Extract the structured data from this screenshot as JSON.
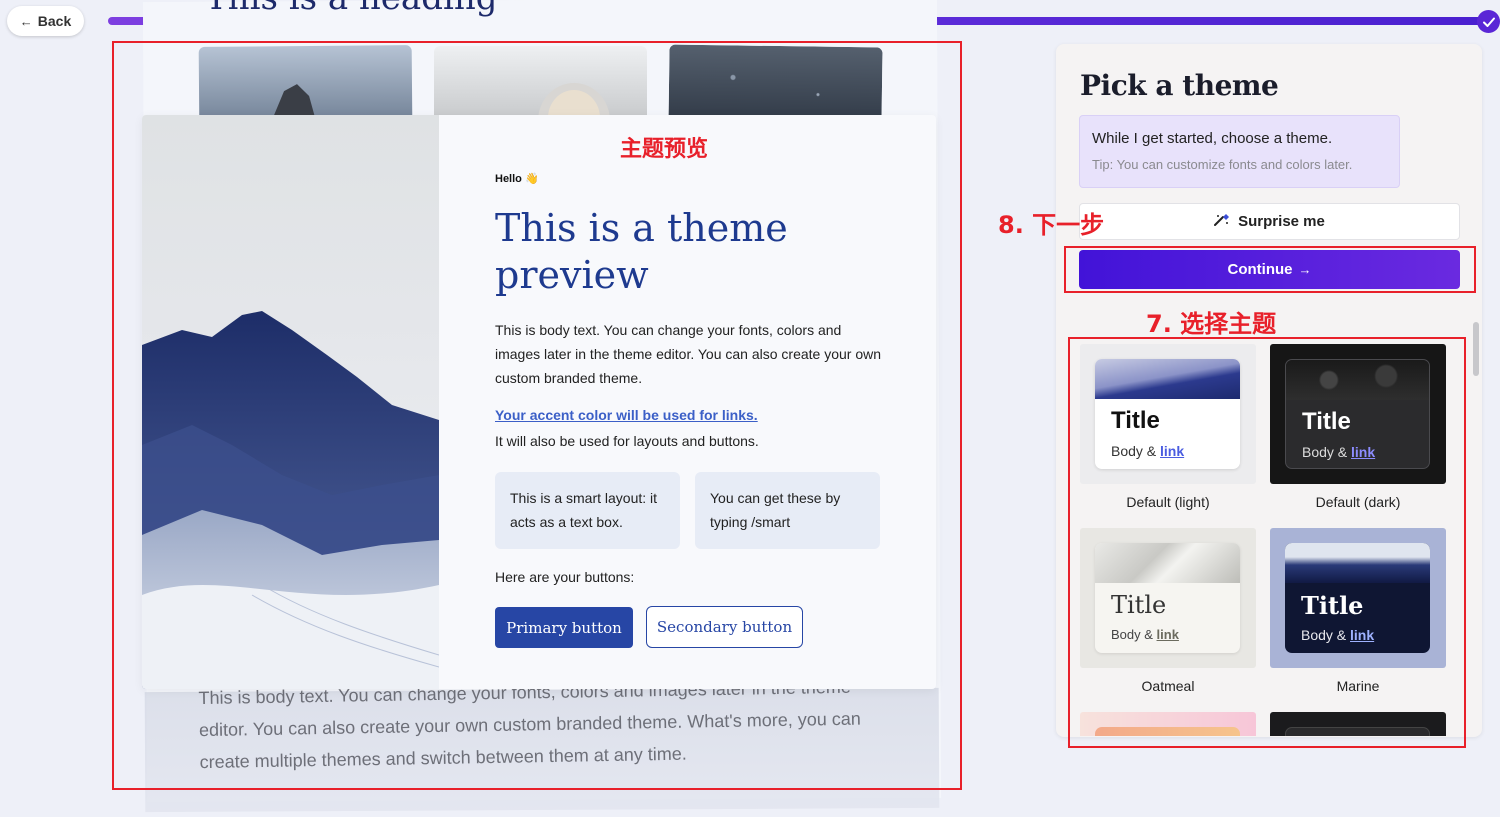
{
  "nav": {
    "back_label": "Back"
  },
  "background_doc": {
    "heading": "This is a heading",
    "body_text": "This is body text. You can change your fonts, colors and images later in the theme editor. You can also create your own custom branded theme. What's more, you can create multiple themes and switch between them at any time."
  },
  "preview": {
    "hello": "Hello 👋",
    "title": "This is a theme preview",
    "body": "This is body text. You can change your fonts, colors and images later in the theme editor. You can also create your own custom branded theme.",
    "accent_link": "Your accent color will be used for links.",
    "accent_note": "It will also be used for layouts and buttons.",
    "smart_box_1": "This is a smart layout: it acts as a  text box.",
    "smart_box_2": "You can get these by typing /smart",
    "buttons_label": "Here are your buttons:",
    "primary_button": "Primary button",
    "secondary_button": "Secondary button"
  },
  "annotations": {
    "preview_label": "主题预览",
    "next_label": "8. 下一步",
    "choose_label": "7. 选择主题",
    "color": "#e8202a"
  },
  "panel": {
    "title": "Pick a theme",
    "tip_main": "While I get started, choose a theme.",
    "tip_sub": "Tip: You can customize fonts and colors later.",
    "surprise_label": "Surprise me",
    "continue_label": "Continue",
    "themes": [
      {
        "name": "Default (light)",
        "card_title": "Title",
        "card_body": "Body & ",
        "card_link": "link"
      },
      {
        "name": "Default (dark)",
        "card_title": "Title",
        "card_body": "Body & ",
        "card_link": "link"
      },
      {
        "name": "Oatmeal",
        "card_title": "Title",
        "card_body": "Body & ",
        "card_link": "link"
      },
      {
        "name": "Marine",
        "card_title": "Title",
        "card_body": "Body & ",
        "card_link": "link"
      }
    ]
  },
  "colors": {
    "accent": "#3b5fc7",
    "primary_button": "#2746a5",
    "continue_button": "#4213d8",
    "title_color": "#1e3a8f"
  },
  "icons": {
    "back": "arrow-left-icon",
    "progress_done": "check-icon",
    "surprise": "magic-wand-icon",
    "continue": "arrow-right-icon"
  }
}
